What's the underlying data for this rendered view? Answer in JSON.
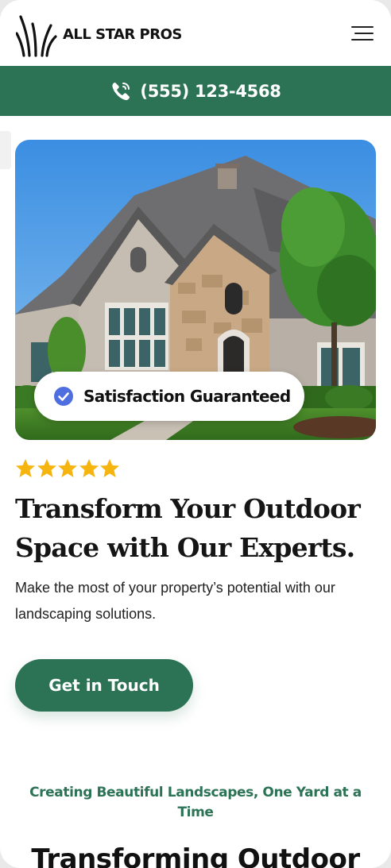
{
  "header": {
    "brand": "ALL STAR PROS",
    "logo_icon": "grass-logo-icon",
    "menu_icon": "hamburger-menu-icon"
  },
  "phone_bar": {
    "icon": "phone-icon",
    "number": "(555) 123-4568"
  },
  "hero": {
    "image": "house-photo",
    "badge_icon": "check-circle-icon",
    "badge_text": "Satisfaction Guaranteed"
  },
  "rating": {
    "stars": 5,
    "star_icon": "star-icon"
  },
  "main": {
    "title": "Transform Your Outdoor Space with Our Experts.",
    "description": "Make the most of your property’s potential with our landscaping solutions.",
    "cta_label": "Get in Touch"
  },
  "section": {
    "subtitle": "Creating Beautiful Landscapes, One Yard at a Time",
    "heading": "Transforming Outdoor"
  },
  "colors": {
    "brand_green": "#2c7255",
    "star_yellow": "#f6b40e",
    "check_blue": "#4f6fe0"
  }
}
